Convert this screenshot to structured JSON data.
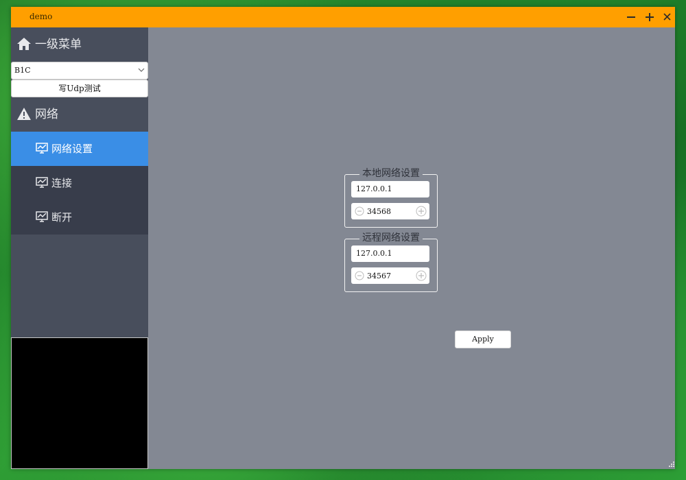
{
  "window": {
    "title": "demo",
    "controls": {
      "minimize_icon": "minus-icon",
      "maximize_icon": "plus-icon",
      "close_icon": "close-icon"
    }
  },
  "colors": {
    "titlebar": "#ff9f00",
    "sidebar": "#484e5c",
    "submenu": "#383d4b",
    "active_item": "#3a8ee6",
    "content_bg": "#838893"
  },
  "sidebar": {
    "menu1": {
      "icon": "home-icon",
      "label": "一级菜单"
    },
    "select": {
      "value": "B1C",
      "icon": "chevron-down-icon"
    },
    "udp_button": {
      "label": "写Udp测试"
    },
    "menu2": {
      "icon": "warning-icon",
      "label": "网络"
    },
    "items": [
      {
        "icon": "chart-icon",
        "label": "网络设置",
        "active": true
      },
      {
        "icon": "chart-icon",
        "label": "连接",
        "active": false
      },
      {
        "icon": "chart-icon",
        "label": "断开",
        "active": false
      }
    ]
  },
  "main": {
    "local": {
      "title": "本地网络设置",
      "ip": "127.0.0.1",
      "port": "34568"
    },
    "remote": {
      "title": "远程网络设置",
      "ip": "127.0.0.1",
      "port": "34567"
    },
    "apply_label": "Apply"
  }
}
